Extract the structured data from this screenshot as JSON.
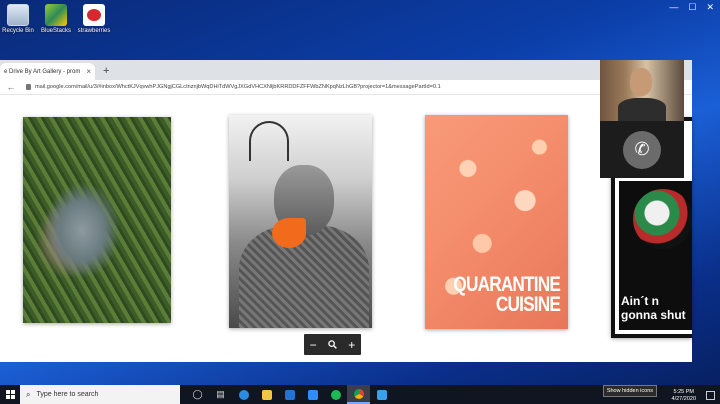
{
  "desktop": {
    "icons": [
      {
        "label": "Recycle Bin",
        "icon": "recycle-bin-icon"
      },
      {
        "label": "BlueStacks",
        "icon": "bluestacks-icon"
      },
      {
        "label": "strawberries",
        "icon": "strawberries-icon"
      }
    ]
  },
  "browser": {
    "tab_title": "e Drive By Art Gallery - prom",
    "new_tab": "+",
    "url": "mail.google.com/mail/u/3/#inbox/WhctKJVqvwhPJGNgjCGLctnznjbWqDHiTdWVgJXGdVHCXNljbKRRDDFZFFWbZNKpqNzLhGB?projector=1&messagePartId=0.1"
  },
  "gallery": {
    "pasta_title_line1": "QUARANTINE",
    "pasta_title_line2": "CUISINE",
    "poster_line1": "Ain´t n",
    "poster_line2": "gonna shut",
    "zoom_out": "−",
    "zoom_icon": "magnifier-icon",
    "zoom_in": "+"
  },
  "call": {
    "hangup_icon": "phone-icon"
  },
  "taskbar": {
    "search_placeholder": "Type here to search",
    "tooltip": "Show hidden icons",
    "time": "5:25 PM",
    "date": "4/27/2020"
  }
}
